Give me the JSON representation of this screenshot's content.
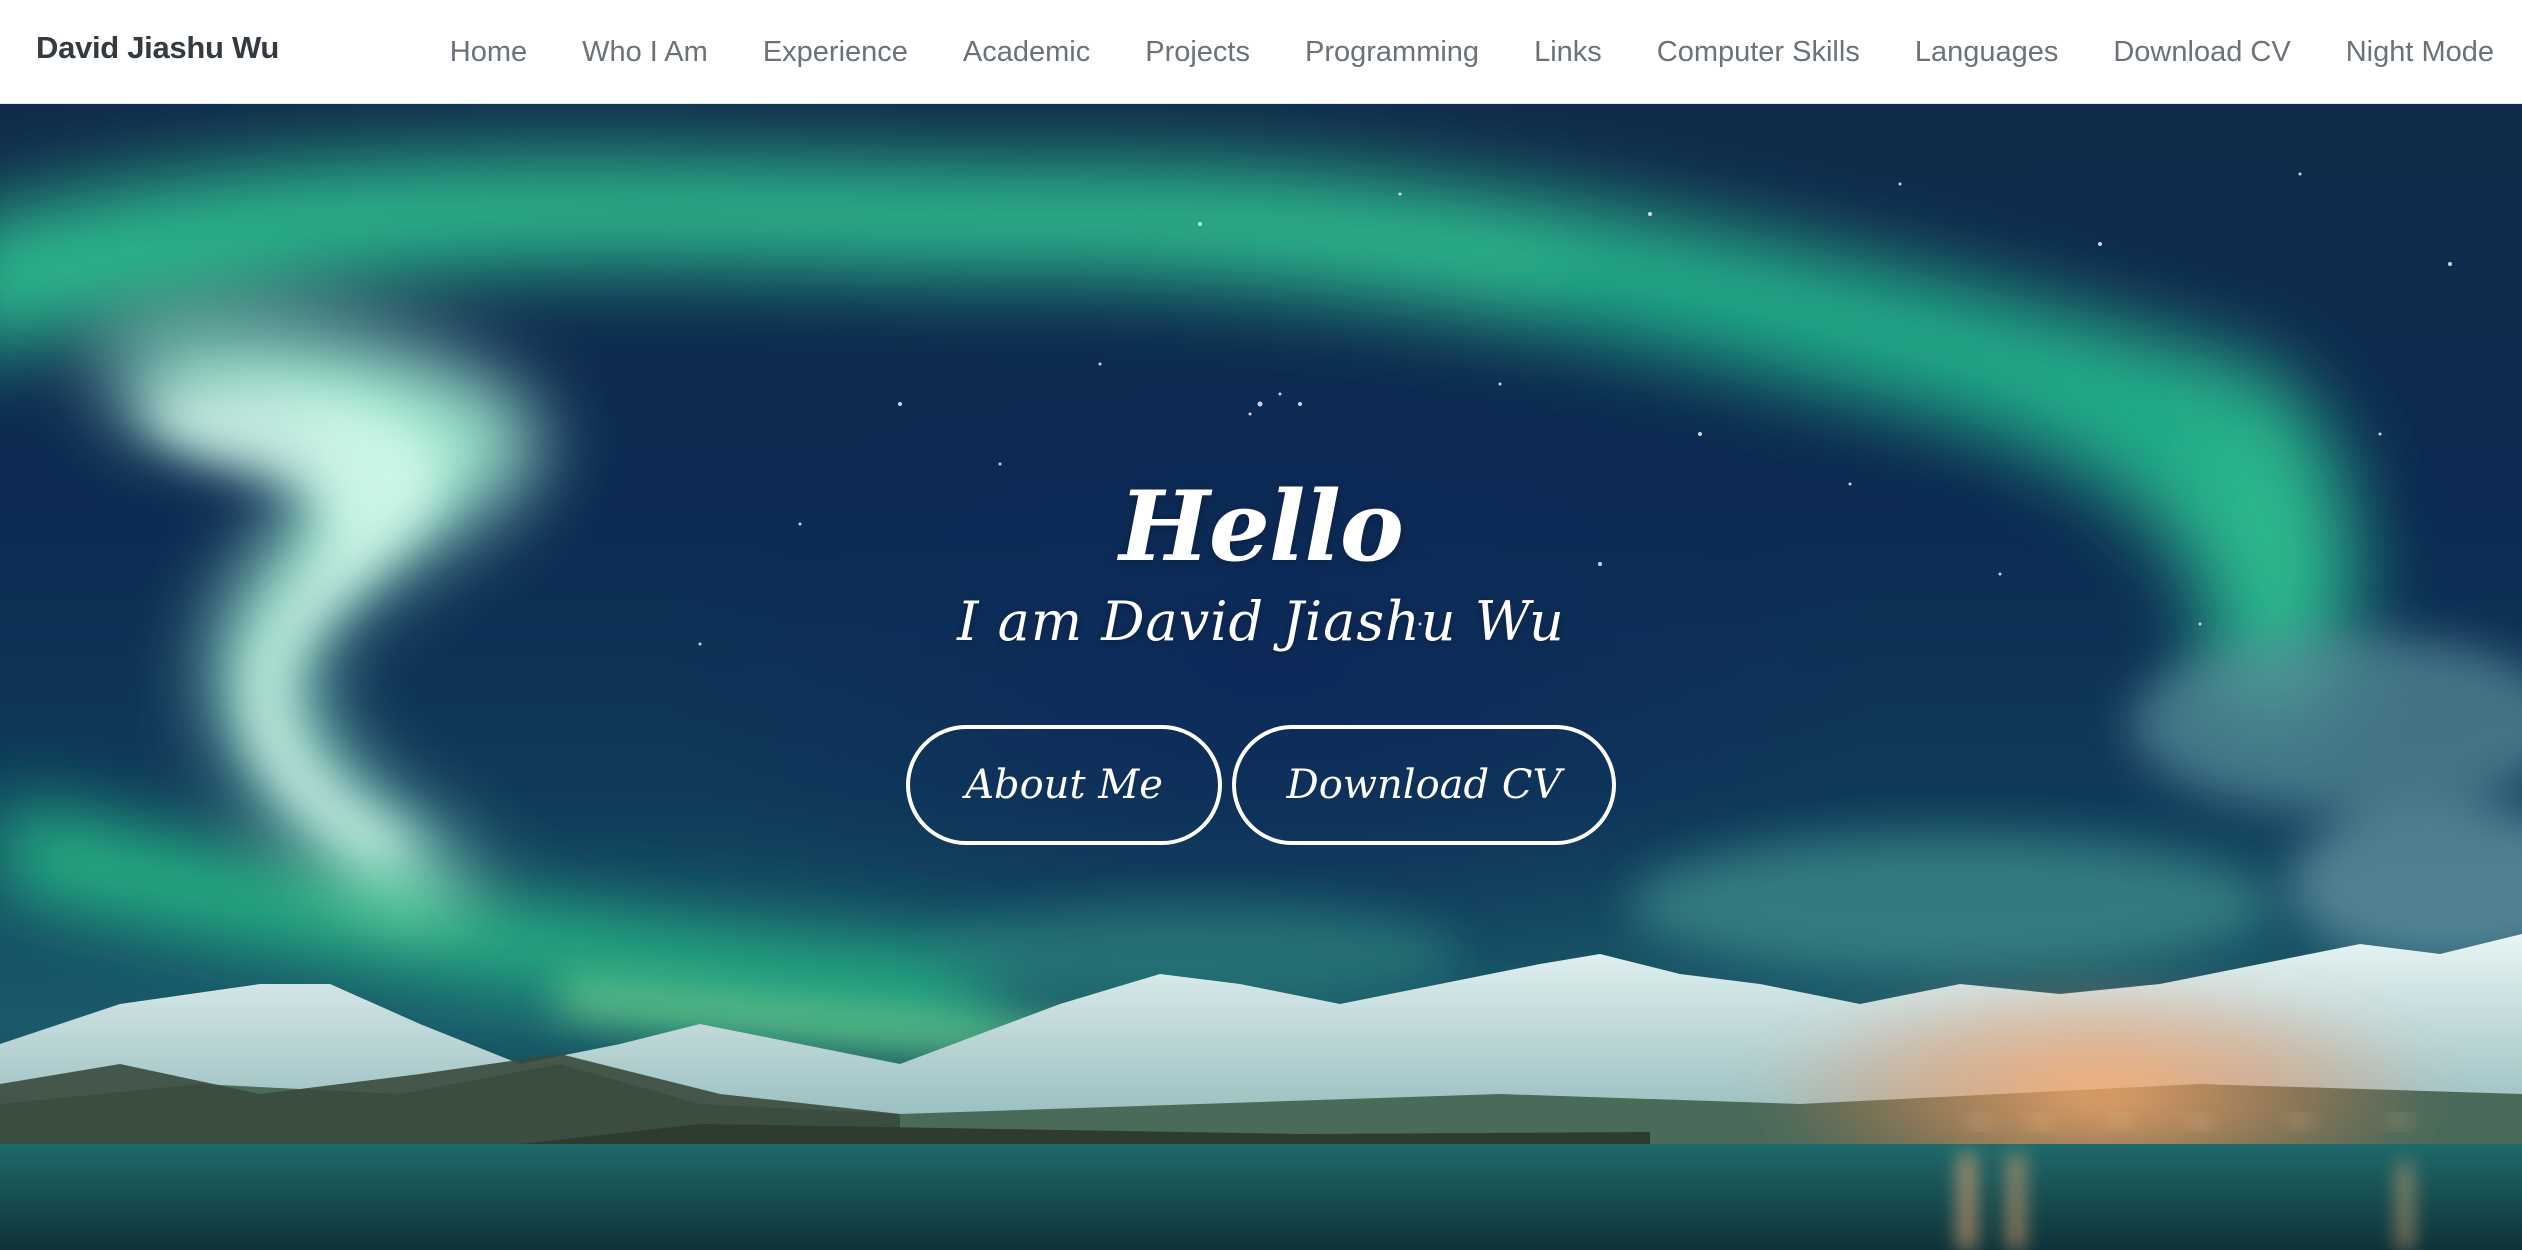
{
  "navbar": {
    "brand": "David Jiashu Wu",
    "links": [
      "Home",
      "Who I Am",
      "Experience",
      "Academic",
      "Projects",
      "Programming",
      "Links",
      "Computer Skills",
      "Languages",
      "Download CV",
      "Night Mode"
    ]
  },
  "hero": {
    "title": "Hello",
    "subtitle": "I am David Jiashu Wu",
    "buttons": {
      "about": "About Me",
      "cv": "Download CV"
    }
  },
  "colors": {
    "nav_bg": "#ffffff",
    "brand_text": "#333a40",
    "nav_link": "#6b7279",
    "aurora_green": "#3ee0a8",
    "sky_dark": "#0c2a52",
    "button_border": "#ffffff"
  }
}
